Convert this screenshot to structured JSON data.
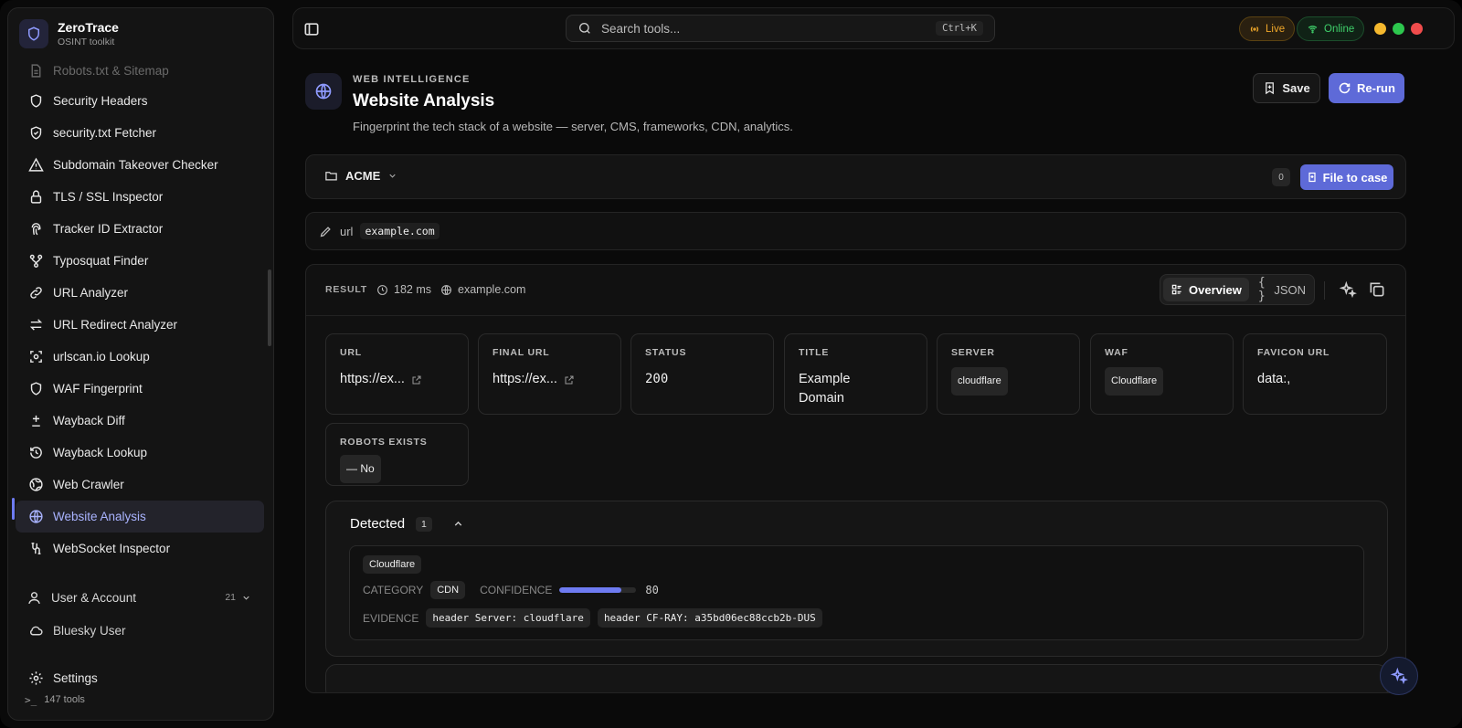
{
  "app": {
    "name": "ZeroTrace",
    "subtitle": "OSINT toolkit"
  },
  "sidebar": {
    "items": [
      {
        "label": "Robots.txt & Sitemap",
        "icon": "file-icon"
      },
      {
        "label": "Security Headers",
        "icon": "shield-icon"
      },
      {
        "label": "security.txt Fetcher",
        "icon": "shield-check-icon"
      },
      {
        "label": "Subdomain Takeover Checker",
        "icon": "warning-icon"
      },
      {
        "label": "TLS / SSL Inspector",
        "icon": "lock-icon"
      },
      {
        "label": "Tracker ID Extractor",
        "icon": "fingerprint-icon"
      },
      {
        "label": "Typosquat Finder",
        "icon": "branch-icon"
      },
      {
        "label": "URL Analyzer",
        "icon": "link-icon"
      },
      {
        "label": "URL Redirect Analyzer",
        "icon": "arrows-icon"
      },
      {
        "label": "urlscan.io Lookup",
        "icon": "scan-icon"
      },
      {
        "label": "WAF Fingerprint",
        "icon": "shield-icon"
      },
      {
        "label": "Wayback Diff",
        "icon": "diff-icon"
      },
      {
        "label": "Wayback Lookup",
        "icon": "history-icon"
      },
      {
        "label": "Web Crawler",
        "icon": "web-icon"
      },
      {
        "label": "Website Analysis",
        "icon": "globe-icon",
        "active": true
      },
      {
        "label": "WebSocket Inspector",
        "icon": "socket-icon"
      }
    ],
    "group": {
      "label": "User & Account",
      "count": "21"
    },
    "bluesky": "Bluesky User",
    "settings": "Settings",
    "tools_count": "147 tools"
  },
  "topbar": {
    "search_placeholder": "Search tools...",
    "shortcut": "Ctrl+K",
    "live": "Live",
    "online": "Online"
  },
  "header": {
    "eyebrow": "WEB INTELLIGENCE",
    "title": "Website Analysis",
    "description": "Fingerprint the tech stack of a website — server, CMS, frameworks, CDN, analytics.",
    "save": "Save",
    "rerun": "Re-run"
  },
  "case": {
    "name": "ACME",
    "count": "0",
    "file_button": "File to case"
  },
  "input": {
    "param": "url",
    "value": "example.com"
  },
  "result": {
    "label": "RESULT",
    "duration": "182 ms",
    "target": "example.com",
    "view_overview": "Overview",
    "view_json": "JSON",
    "cards": {
      "url": {
        "key": "URL",
        "value": "https://ex..."
      },
      "final_url": {
        "key": "FINAL URL",
        "value": "https://ex..."
      },
      "status": {
        "key": "STATUS",
        "value": "200"
      },
      "title": {
        "key": "TITLE",
        "value": "Example Domain"
      },
      "server": {
        "key": "SERVER",
        "value": "cloudflare"
      },
      "waf": {
        "key": "WAF",
        "value": "Cloudflare"
      },
      "favicon": {
        "key": "FAVICON URL",
        "value": "data:,"
      },
      "robots": {
        "key": "ROBOTS EXISTS",
        "value": "No"
      }
    },
    "detected": {
      "title": "Detected",
      "count": "1",
      "tech": "Cloudflare",
      "category_label": "CATEGORY",
      "category": "CDN",
      "confidence_label": "CONFIDENCE",
      "confidence": 80,
      "confidence_text": "80",
      "evidence_label": "EVIDENCE",
      "evidence": [
        "header Server: cloudflare",
        "header CF-RAY: a35bd06ec88ccb2b-DUS"
      ]
    }
  },
  "colors": {
    "accent": "#5e6ad8",
    "live": "#f0a72a",
    "online": "#3fcf6a"
  }
}
